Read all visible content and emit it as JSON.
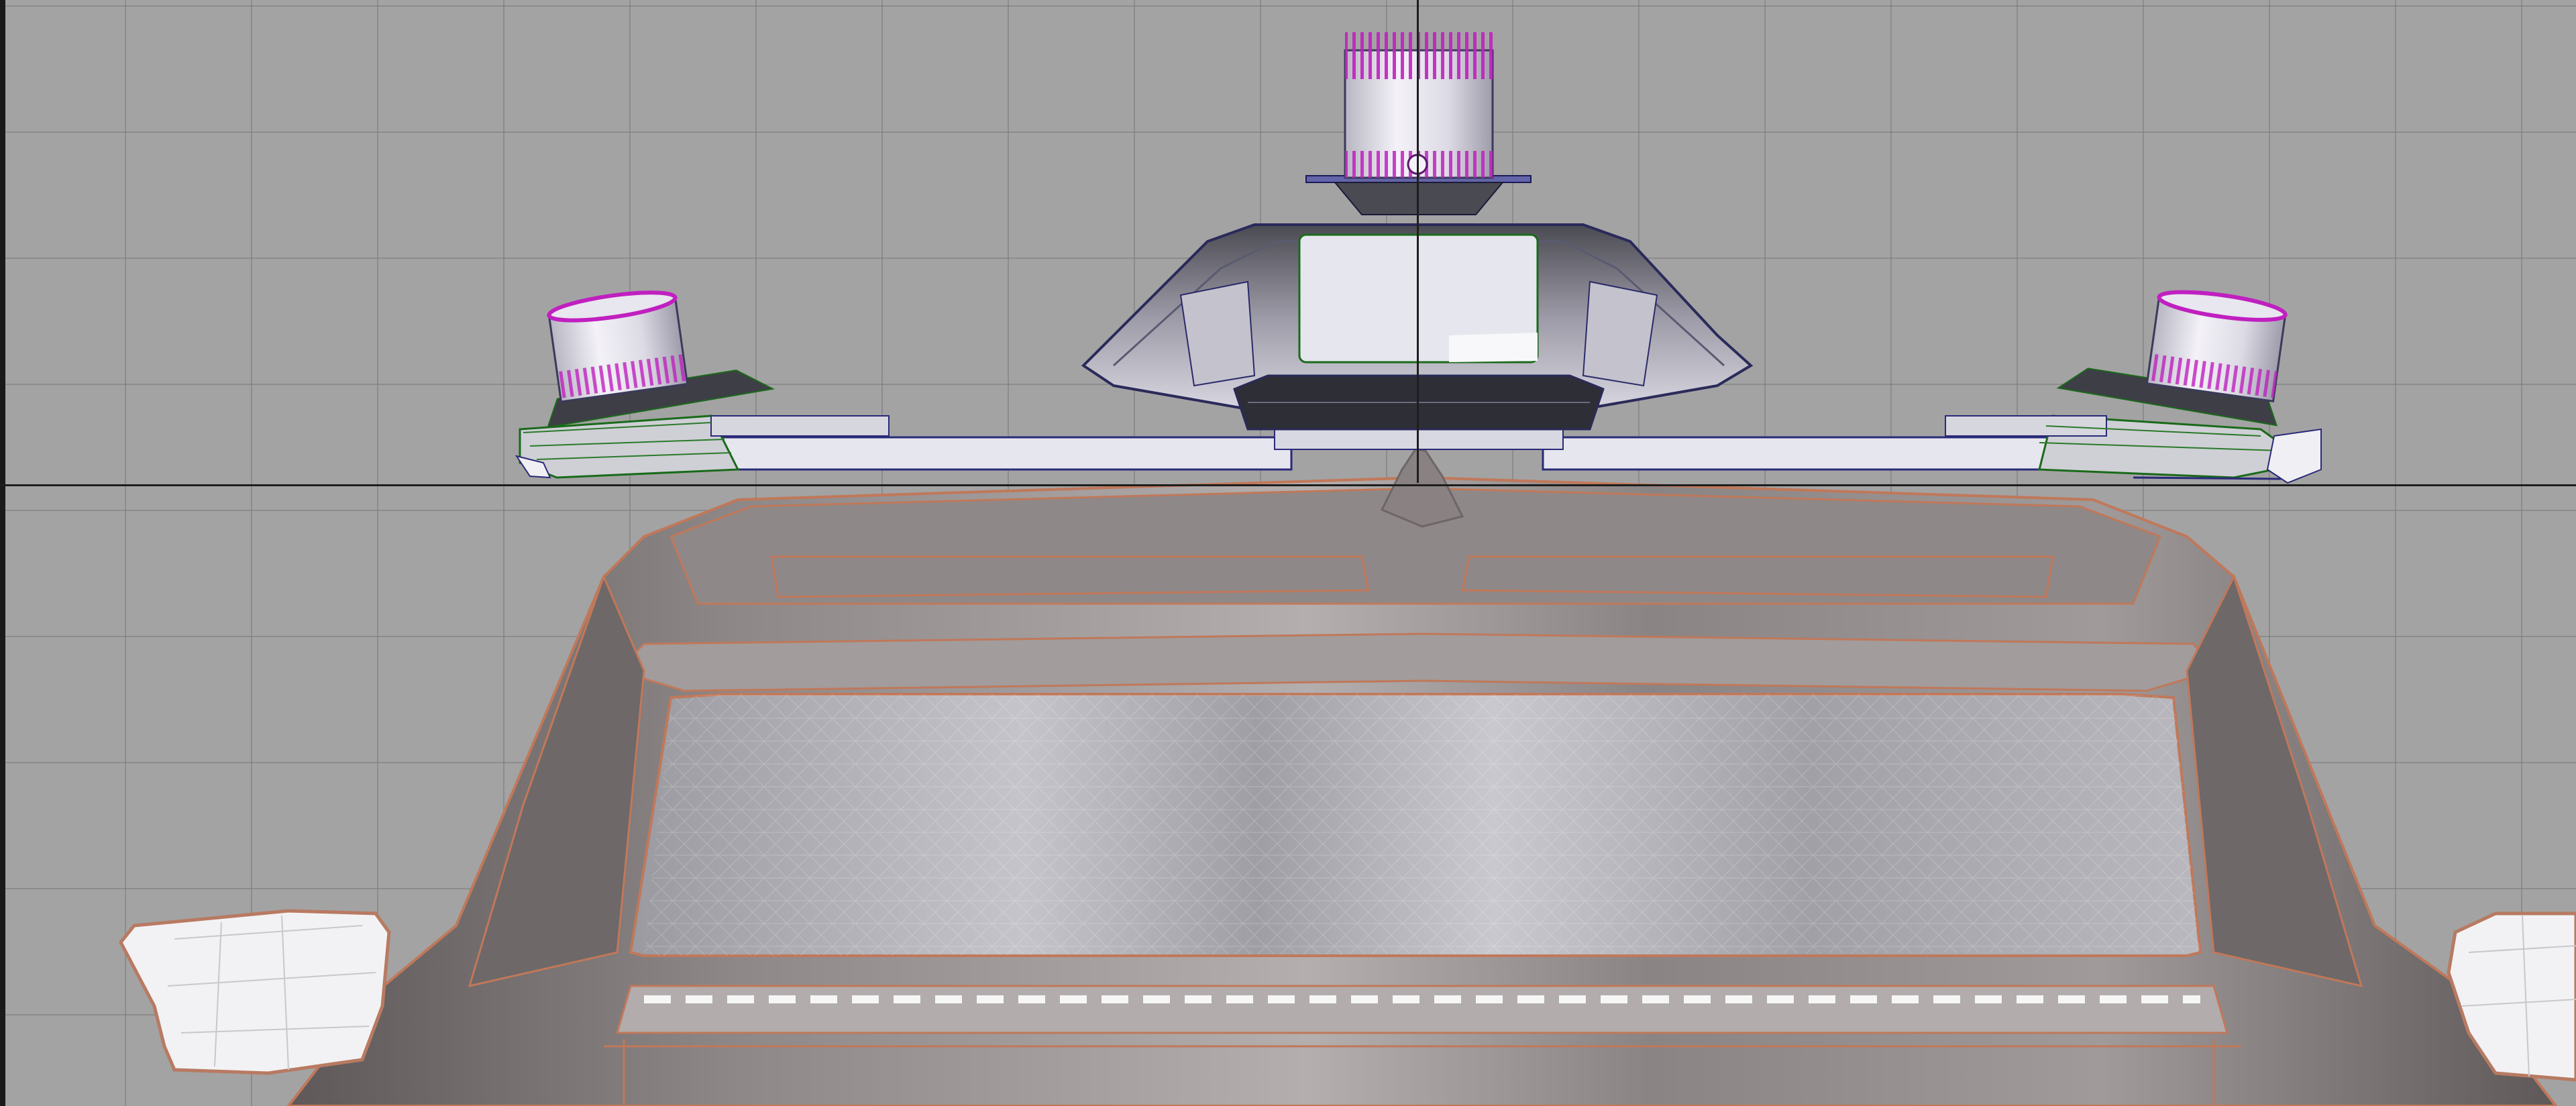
{
  "viewport": {
    "background": "#a3a3a3",
    "grid_color": "#7a7a7a",
    "axis_color": "#1e1e1e",
    "render_mode": "wireframe-shaded"
  },
  "objects": [
    {
      "name": "vehicle-body",
      "kind": "vehicle front",
      "color": "#8c8686",
      "wire": "#c0785a"
    },
    {
      "name": "roof-sensor-rack",
      "kind": "sensor rack",
      "color": "#e4e4ec",
      "wire": "#2a2a7a"
    },
    {
      "name": "center-lidar",
      "kind": "lidar",
      "color": "#e8e6ee",
      "accent": "#c020c0"
    },
    {
      "name": "left-lidar",
      "kind": "lidar",
      "color": "#e8e6ee",
      "accent": "#c020c0"
    },
    {
      "name": "right-lidar",
      "kind": "lidar",
      "color": "#e8e6ee",
      "accent": "#c020c0"
    },
    {
      "name": "shark-fin-antenna",
      "kind": "antenna",
      "color": "#8a8282"
    },
    {
      "name": "left-mirror",
      "kind": "side mirror",
      "color": "#f2f2f4"
    },
    {
      "name": "right-mirror",
      "kind": "side mirror",
      "color": "#f2f2f4"
    }
  ]
}
